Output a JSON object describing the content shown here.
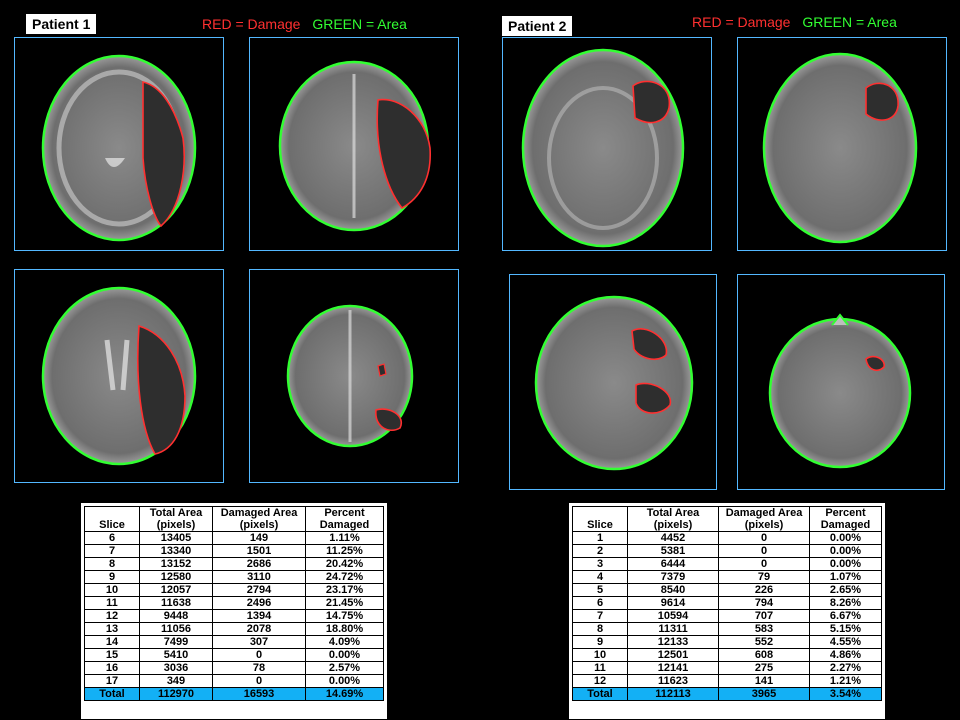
{
  "patient1": {
    "title": "Patient 1",
    "legend_red": "RED = Damage",
    "legend_green": "GREEN = Area",
    "table": {
      "headers": [
        "Slice",
        "Total Area (pixels)",
        "Damaged Area (pixels)",
        "Percent Damaged"
      ],
      "rows": [
        [
          "6",
          "13405",
          "149",
          "1.11%"
        ],
        [
          "7",
          "13340",
          "1501",
          "11.25%"
        ],
        [
          "8",
          "13152",
          "2686",
          "20.42%"
        ],
        [
          "9",
          "12580",
          "3110",
          "24.72%"
        ],
        [
          "10",
          "12057",
          "2794",
          "23.17%"
        ],
        [
          "11",
          "11638",
          "2496",
          "21.45%"
        ],
        [
          "12",
          "9448",
          "1394",
          "14.75%"
        ],
        [
          "13",
          "11056",
          "2078",
          "18.80%"
        ],
        [
          "14",
          "7499",
          "307",
          "4.09%"
        ],
        [
          "15",
          "5410",
          "0",
          "0.00%"
        ],
        [
          "16",
          "3036",
          "78",
          "2.57%"
        ],
        [
          "17",
          "349",
          "0",
          "0.00%"
        ]
      ],
      "total": [
        "Total",
        "112970",
        "16593",
        "14.69%"
      ]
    }
  },
  "patient2": {
    "title": "Patient 2",
    "legend_red": "RED = Damage",
    "legend_green": "GREEN = Area",
    "table": {
      "headers": [
        "Slice",
        "Total Area (pixels)",
        "Damaged Area (pixels)",
        "Percent Damaged"
      ],
      "rows": [
        [
          "1",
          "4452",
          "0",
          "0.00%"
        ],
        [
          "2",
          "5381",
          "0",
          "0.00%"
        ],
        [
          "3",
          "6444",
          "0",
          "0.00%"
        ],
        [
          "4",
          "7379",
          "79",
          "1.07%"
        ],
        [
          "5",
          "8540",
          "226",
          "2.65%"
        ],
        [
          "6",
          "9614",
          "794",
          "8.26%"
        ],
        [
          "7",
          "10594",
          "707",
          "6.67%"
        ],
        [
          "8",
          "11311",
          "583",
          "5.15%"
        ],
        [
          "9",
          "12133",
          "552",
          "4.55%"
        ],
        [
          "10",
          "12501",
          "608",
          "4.86%"
        ],
        [
          "11",
          "12141",
          "275",
          "2.27%"
        ],
        [
          "12",
          "11623",
          "141",
          "1.21%"
        ]
      ],
      "total": [
        "Total",
        "112113",
        "3965",
        "3.54%"
      ]
    }
  },
  "colors": {
    "damage_outline": "#ff3030",
    "area_outline": "#32ff32",
    "frame": "#53b8ff",
    "total_row": "#13b0f5"
  }
}
